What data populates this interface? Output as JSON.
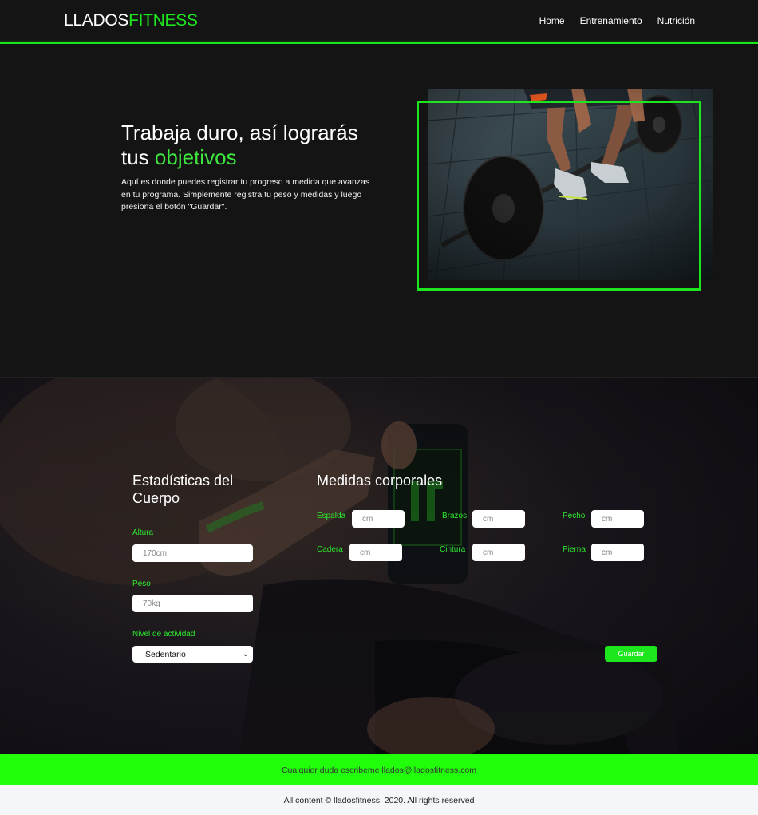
{
  "nav": {
    "logo_part1": "LLADOS",
    "logo_part2": "FITNESS",
    "links": [
      "Home",
      "Entrenamiento",
      "Nutrición"
    ],
    "accent_color": "#1ee61e"
  },
  "hero": {
    "title_line1": "Trabaja duro, así lograrás",
    "title_prefix": "tus",
    "title_accent": "objetivos",
    "description": "Aquí es donde puedes registrar tu progreso a medida que avanzas en tu programa. Simplemente registra tu peso y medidas y luego presiona el botón \"Guardar\".",
    "image": "deadlift-barbell-photo"
  },
  "stats": {
    "body_title": "Estadísticas del Cuerpo",
    "height_label": "Altura",
    "height_placeholder": "170cm",
    "weight_label": "Peso",
    "weight_placeholder": "70kg",
    "activity_label": "Nivel de actividad",
    "activity_selected": "Sedentario",
    "measures_title": "Medidas corporales",
    "measures": {
      "espalda": {
        "label": "Espalda",
        "placeholder": "cm"
      },
      "brazos": {
        "label": "Brazos",
        "placeholder": "cm"
      },
      "pecho": {
        "label": "Pecho",
        "placeholder": "cm"
      },
      "cadera": {
        "label": "Cadera",
        "placeholder": "cm"
      },
      "cintura": {
        "label": "Cintura",
        "placeholder": "cm"
      },
      "pierna": {
        "label": "Pierna",
        "placeholder": "cm"
      }
    },
    "save_button": "Guardar",
    "background_image": "athlete-with-shaker-photo"
  },
  "footer": {
    "contact": "Cualquier duda escribeme llados@lladosfitness.com",
    "copyright": "All content © lladosfitness, 2020. All rights reserved"
  }
}
